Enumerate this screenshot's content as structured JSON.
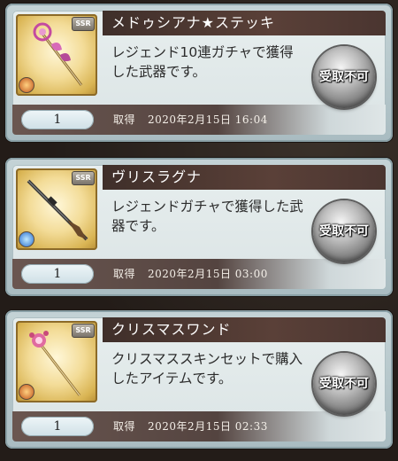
{
  "items": [
    {
      "name": "メドゥシアナ★ステッキ",
      "description": "レジェンド10連ガチャで獲得した武器です。",
      "quantity": "1",
      "acquired_label": "取得",
      "acquired_date": "2020年2月15日 16:04",
      "button_label": "受取不可",
      "rarity": "SSR",
      "element": "fire",
      "item_icon": "staff-icon"
    },
    {
      "name": "ヴリスラグナ",
      "description": "レジェンドガチャで獲得した武器です。",
      "quantity": "1",
      "acquired_label": "取得",
      "acquired_date": "2020年2月15日 03:00",
      "button_label": "受取不可",
      "rarity": "SSR",
      "element": "water",
      "item_icon": "rifle-icon"
    },
    {
      "name": "クリスマスワンド",
      "description": "クリスマススキンセットで購入したアイテムです。",
      "quantity": "1",
      "acquired_label": "取得",
      "acquired_date": "2020年2月15日 02:33",
      "button_label": "受取不可",
      "rarity": "SSR",
      "element": "fire",
      "item_icon": "wand-icon"
    }
  ]
}
